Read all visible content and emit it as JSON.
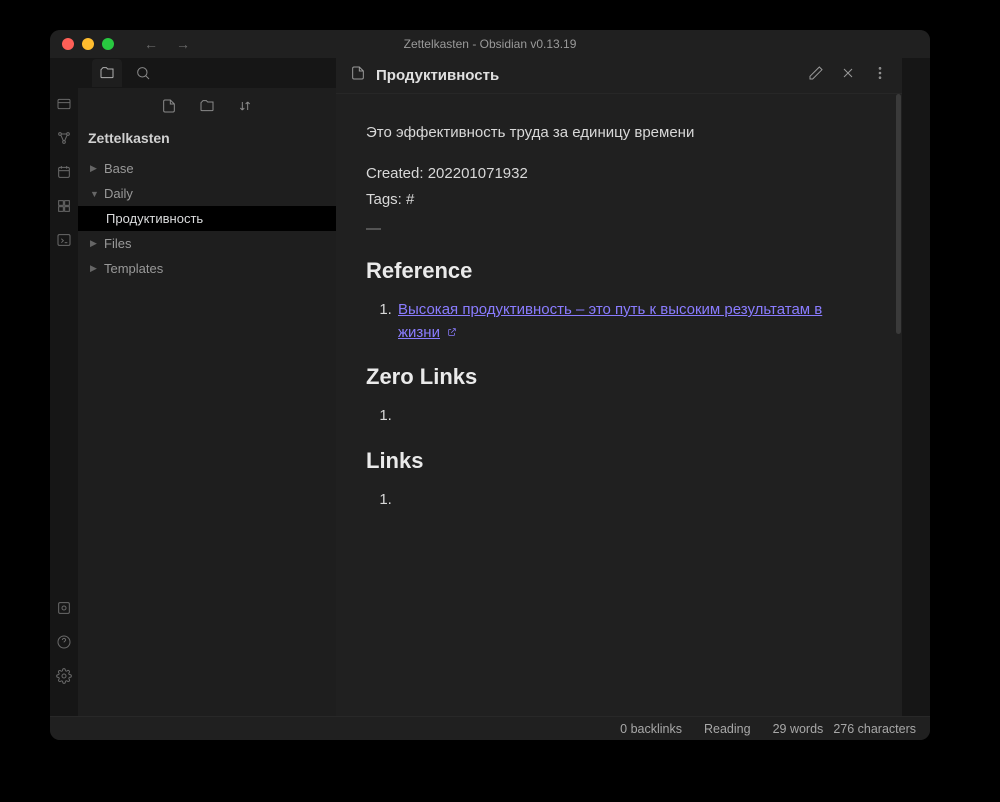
{
  "window": {
    "title": "Zettelkasten - Obsidian v0.13.19"
  },
  "sidebar": {
    "vault_name": "Zettelkasten",
    "tree": [
      {
        "label": "Base",
        "expanded": false,
        "level": 0
      },
      {
        "label": "Daily",
        "expanded": true,
        "level": 0
      },
      {
        "label": "Продуктивность",
        "active": true,
        "level": 1
      },
      {
        "label": "Files",
        "expanded": false,
        "level": 0
      },
      {
        "label": "Templates",
        "expanded": false,
        "level": 0
      }
    ]
  },
  "note": {
    "title": "Продуктивность",
    "description": "Это эффективность труда за единицу времени",
    "created_label": "Created:",
    "created_value": "202201071932",
    "tags_label": "Tags:",
    "tags_value": "#",
    "separator": "—",
    "headings": {
      "reference": "Reference",
      "zero_links": "Zero Links",
      "links": "Links"
    },
    "references": [
      {
        "text": "Высокая продуктивность – это путь к высоким результатам в жизни",
        "external": true
      }
    ]
  },
  "status": {
    "backlinks": "0 backlinks",
    "mode": "Reading",
    "words": "29 words",
    "chars": "276 characters"
  }
}
